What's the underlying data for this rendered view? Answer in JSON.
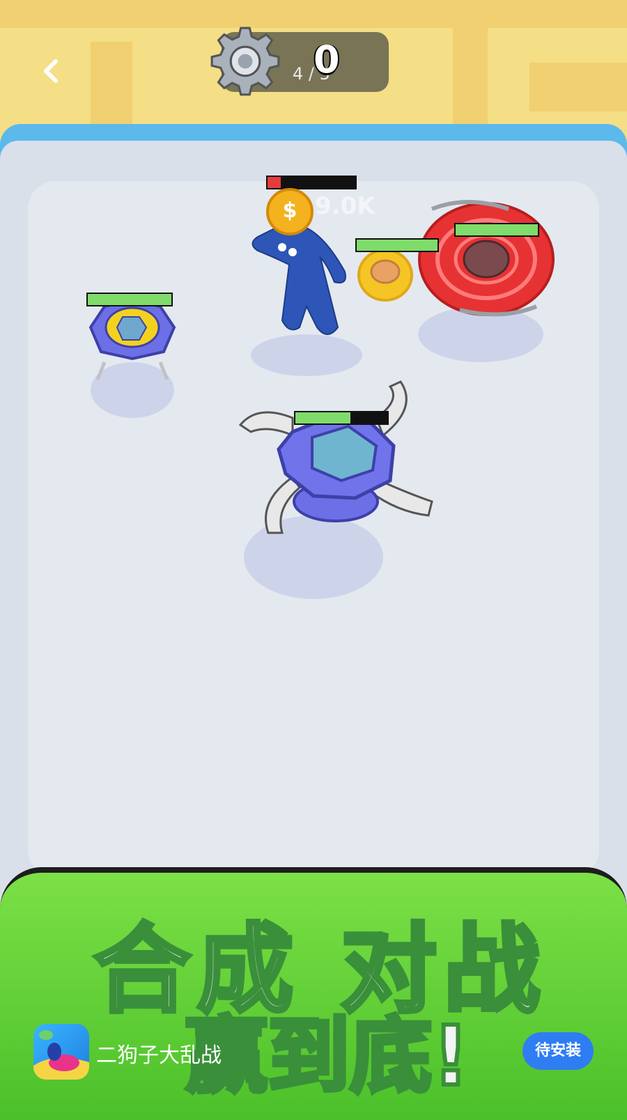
{
  "header": {
    "back_icon": "chevron-left-icon",
    "gear_icon": "gear-icon",
    "progress": "4 / 5",
    "score": "0"
  },
  "arena": {
    "floating_text": "9.0K",
    "coin_symbol": "$"
  },
  "health_bars": [
    {
      "id": "enemy-monster",
      "fill": 0.15,
      "color": "#e43c3c"
    },
    {
      "id": "yellow-spinner",
      "fill": 1.0,
      "color": "#7fdc6a"
    },
    {
      "id": "red-spinner",
      "fill": 1.0,
      "color": "#7fdc6a"
    },
    {
      "id": "left-spinner",
      "fill": 1.0,
      "color": "#7fdc6a"
    },
    {
      "id": "player-spinner",
      "fill": 0.6,
      "color": "#7fdc6a"
    }
  ],
  "banner": {
    "slogan_line1": "合成 对战",
    "slogan_line2": "赢到底!",
    "app_name": "二狗子大乱战",
    "install_label": "待安装"
  },
  "colors": {
    "sky": "#f4de86",
    "arena_rim": "#5cb9ec",
    "arena_floor": "#dfe5ed",
    "banner_green": "#5fcf36",
    "install_blue": "#2f7df3"
  }
}
